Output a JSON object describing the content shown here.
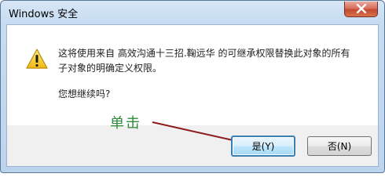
{
  "window": {
    "title": "Windows 安全"
  },
  "dialog": {
    "message_line1": "这将使用来自 高效沟通十三招.鞠远华 的可继承权限替换此对象的所有",
    "message_line2": "子对象的明确定义权限。",
    "question": "您想继续吗?",
    "icon": "warning-icon"
  },
  "buttons": {
    "yes_label": "是(Y)",
    "no_label": "否(N)"
  },
  "annotation": {
    "text": "单击",
    "color": "#2f8a3a",
    "arrow_color": "#8b1a1a"
  },
  "colors": {
    "accent": "#3c7fb1",
    "close_button": "#c24a32"
  }
}
